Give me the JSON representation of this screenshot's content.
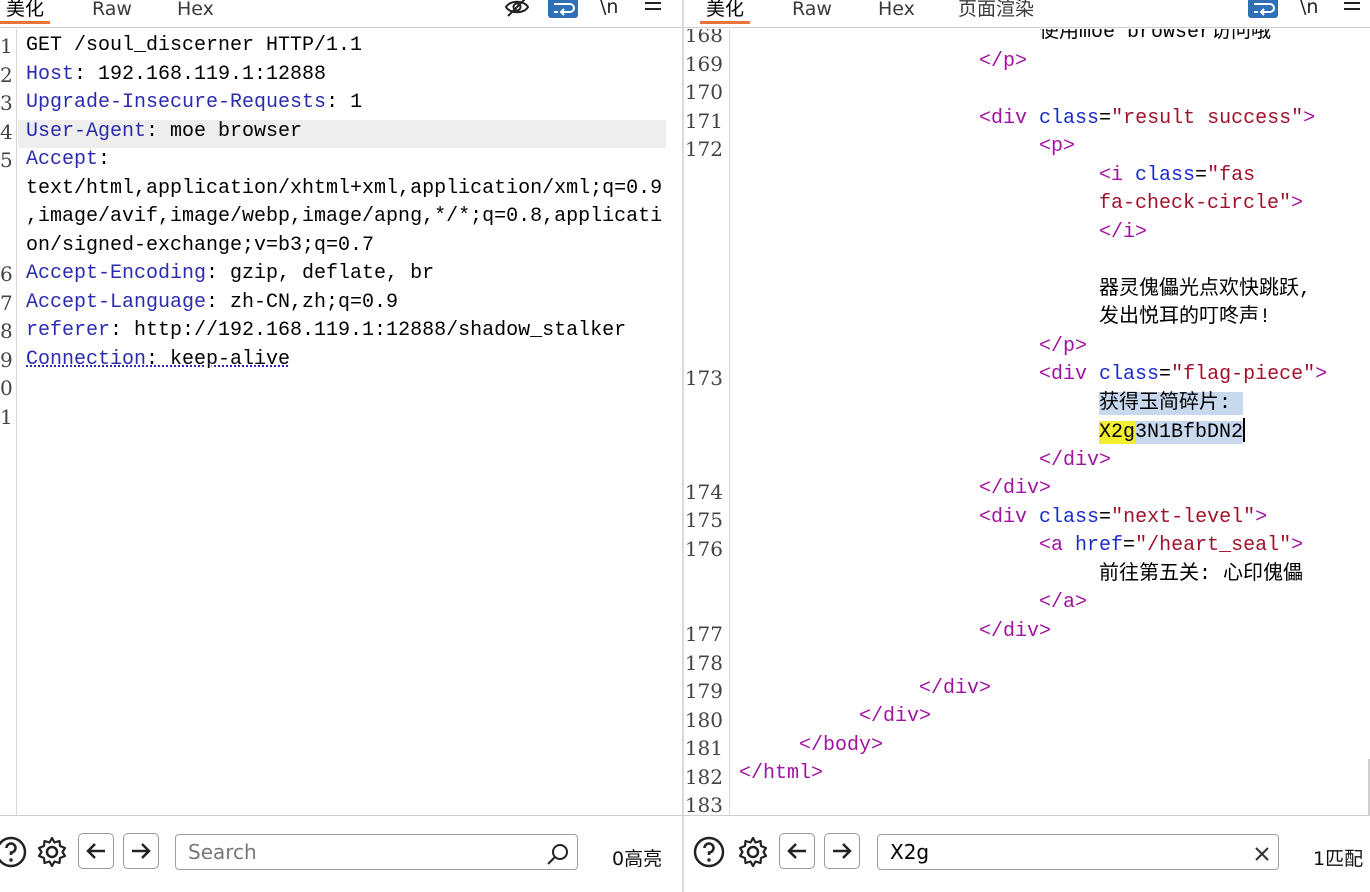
{
  "left": {
    "tabs": [
      {
        "label": "美化"
      },
      {
        "label": "Raw"
      },
      {
        "label": "Hex"
      }
    ],
    "tools": {
      "newline": "\\n"
    },
    "line_numbers": [
      "1",
      "2",
      "3",
      "4",
      "5",
      "6",
      "7",
      "8",
      "9",
      "0",
      "1"
    ],
    "lines": [
      {
        "text": "GET /soul_discerner HTTP/1.1"
      },
      {
        "key": "Host",
        "value": ": 192.168.119.1:12888"
      },
      {
        "key": "Upgrade-Insecure-Requests",
        "value": ": 1"
      },
      {
        "key": "User-Agent",
        "value": ": moe browser"
      },
      {
        "key": "Accept",
        "value": ":"
      },
      {
        "text": "text/html,application/xhtml+xml,application/xml;q=0.9"
      },
      {
        "text": ",image/avif,image/webp,image/apng,*/*;q=0.8,applicati"
      },
      {
        "text": "on/signed-exchange;v=b3;q=0.7"
      },
      {
        "key": "Accept-Encoding",
        "value": ": gzip, deflate, br"
      },
      {
        "key": "Accept-Language",
        "value": ": zh-CN,zh;q=0.9"
      },
      {
        "key": "referer",
        "value": ": http://192.168.119.1:12888/shadow_stalker"
      },
      {
        "key": "Connection",
        "value": ": keep-alive"
      }
    ],
    "search": {
      "placeholder": "Search",
      "value": ""
    },
    "match_count": "0高亮"
  },
  "right": {
    "tabs": [
      {
        "label": "美化"
      },
      {
        "label": "Raw"
      },
      {
        "label": "Hex"
      },
      {
        "label": "页面渲染"
      }
    ],
    "tools": {
      "newline": "\\n"
    },
    "line_numbers": [
      "168",
      "169",
      "170",
      "171",
      "172",
      "173",
      "174",
      "175",
      "176",
      "177",
      "178",
      "179",
      "180",
      "181",
      "182",
      "183"
    ],
    "code": {
      "l168": "使用moe browser访问哦",
      "p_close": "</p>",
      "div_open": "<div",
      "class_attr": "class",
      "eq": "=",
      "result_val": "\"result success\"",
      "gt": ">",
      "p_open": "<p>",
      "i_open": "<i",
      "fas_val_1": "\"fas",
      "fas_val_2": "fa-check-circle\"",
      "i_close": "</i>",
      "msg_1": "器灵傀儡光点欢快跳跃,",
      "msg_2": "发出悦耳的叮咚声!",
      "flag_val": "\"flag-piece\"",
      "flag_text_1": "获得玉简碎片:",
      "flag_match": "X2g",
      "flag_rest": "3N1BfbDN2",
      "div_close": "</div>",
      "next_val": "\"next-level\"",
      "a_open": "<a",
      "href_attr": "href",
      "href_val": "\"/heart_seal\"",
      "link_text": "前往第五关: 心印傀儡",
      "a_close": "</a>",
      "body_close": "</body>",
      "html_close": "</html>"
    },
    "search": {
      "placeholder": "Search",
      "value": "X2g"
    },
    "match_count": "1匹配"
  },
  "colors": {
    "accent_tab": "#e8743b",
    "wrap_button": "#2f6fb6",
    "header_key": "#2b2bb0",
    "tag": "#a112a1",
    "attr": "#1a2bd0",
    "value": "#a0112b",
    "selection": "#c8d8ee",
    "match": "#f2ef2e"
  },
  "icons": [
    "eye-off-icon",
    "wrap-icon",
    "newline-icon",
    "menu-icon",
    "help-icon",
    "gear-icon",
    "arrow-left-icon",
    "arrow-right-icon",
    "search-icon",
    "clear-icon"
  ]
}
